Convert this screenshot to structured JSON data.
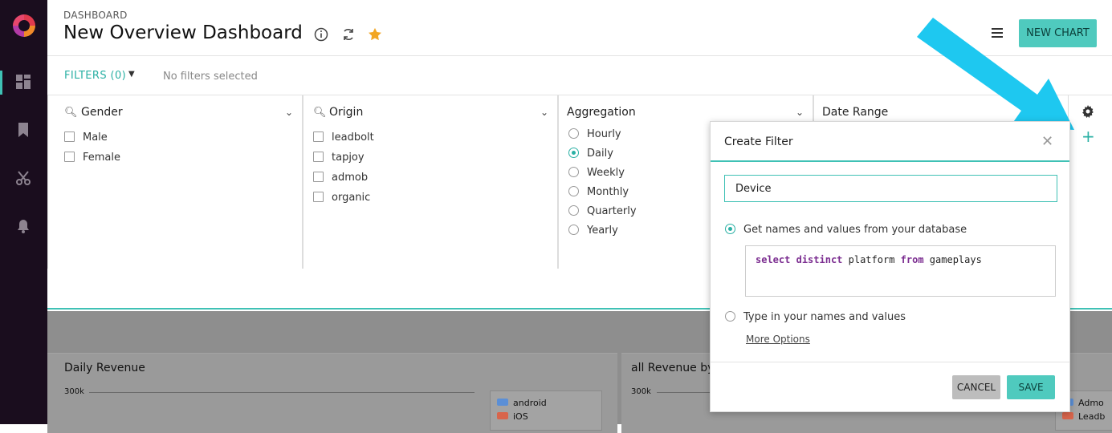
{
  "colors": {
    "accent": "#4fcabe",
    "nav_bg": "#1a0d1e",
    "arrow": "#1ec8f0",
    "sql_keyword": "#7b2d90"
  },
  "nav": {
    "icons": [
      "dashboard-icon",
      "bookmark-icon",
      "scissors-icon",
      "bell-icon"
    ]
  },
  "header": {
    "breadcrumb": "DASHBOARD",
    "title": "New Overview Dashboard",
    "new_chart_label": "NEW CHART"
  },
  "filterbar": {
    "label": "FILTERS (0)",
    "status": "No filters selected"
  },
  "panels": {
    "gender": {
      "title": "Gender",
      "options": [
        "Male",
        "Female"
      ]
    },
    "origin": {
      "title": "Origin",
      "options": [
        "leadbolt",
        "tapjoy",
        "admob",
        "organic"
      ]
    },
    "aggregation": {
      "title": "Aggregation",
      "options": [
        "Hourly",
        "Daily",
        "Weekly",
        "Monthly",
        "Quarterly",
        "Yearly"
      ],
      "selected": "Daily"
    },
    "date_range": {
      "title": "Date Range"
    }
  },
  "dashboard": {
    "card1": {
      "title": "Daily Revenue",
      "ytick": "300k",
      "legend": [
        "android",
        "iOS"
      ],
      "legend_colors": [
        "#5b8fd6",
        "#d8654c"
      ]
    },
    "card2": {
      "title": "all Revenue by",
      "ytick": "300k",
      "legend": [
        "Admo",
        "Leadb"
      ],
      "legend_colors": [
        "#5b8fd6",
        "#d8654c"
      ]
    }
  },
  "modal": {
    "title": "Create Filter",
    "name_value": "Device",
    "option_db": "Get names and values from your database",
    "option_manual": "Type in your names and values",
    "sql": {
      "kw1": "select",
      "kw2": "distinct",
      "ident1": "platform",
      "kw3": "from",
      "ident2": "gameplays"
    },
    "more_options": "More Options",
    "cancel_label": "CANCEL",
    "save_label": "SAVE"
  }
}
